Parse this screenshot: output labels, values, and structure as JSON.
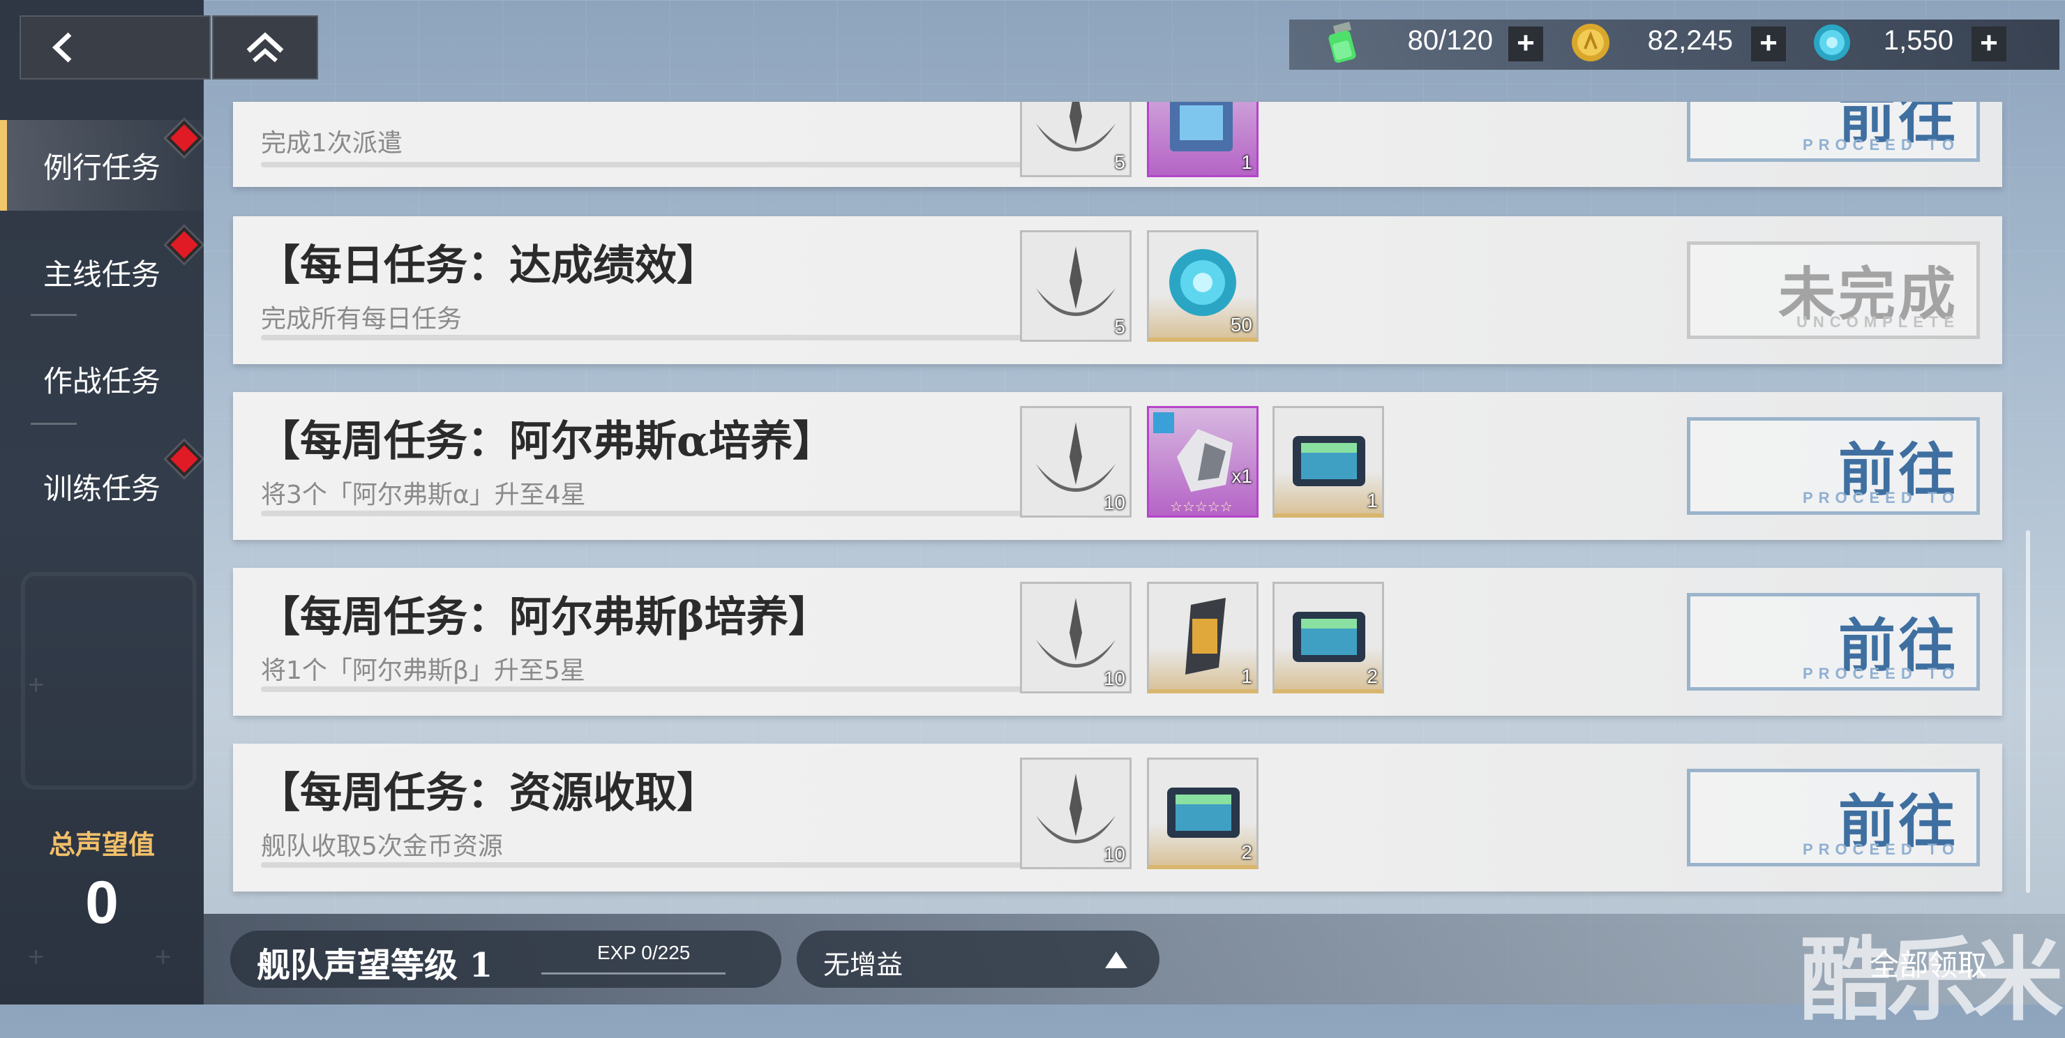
{
  "header": {
    "resources": [
      {
        "icon": "stamina-vial-icon",
        "value": "80/120"
      },
      {
        "icon": "gold-coin-icon",
        "value": "82,245"
      },
      {
        "icon": "crystal-orb-icon",
        "value": "1,550"
      }
    ],
    "plus_label": "+"
  },
  "sidebar": {
    "items": [
      {
        "label": "例行任务",
        "active": true,
        "has_alert": true
      },
      {
        "label": "主线任务",
        "active": false,
        "has_alert": true
      },
      {
        "label": "作战任务",
        "active": false,
        "has_alert": false
      },
      {
        "label": "训练任务",
        "active": false,
        "has_alert": true
      }
    ],
    "reputation_label": "总声望值",
    "reputation_value": "0"
  },
  "tasks": [
    {
      "title": "",
      "description": "完成1次派遣",
      "progress": "0/1",
      "rewards": [
        {
          "icon": "reputation-emblem-icon",
          "count": "5"
        },
        {
          "icon": "blueprint-card-icon",
          "count": "1"
        }
      ],
      "action": {
        "label": "前往",
        "sub": "PROCEED TO"
      }
    },
    {
      "title": "【每日任务：达成绩效】",
      "description": "完成所有每日任务",
      "progress": "0/4",
      "rewards": [
        {
          "icon": "reputation-emblem-icon",
          "count": "5"
        },
        {
          "icon": "crystal-orb-icon",
          "count": "50"
        }
      ],
      "action": {
        "label": "未完成",
        "sub": "UNCOMPLETE"
      }
    },
    {
      "title": "【每周任务：阿尔弗斯α培养】",
      "description": "将3个「阿尔弗斯α」升至4星",
      "progress": "0/3",
      "rewards": [
        {
          "icon": "reputation-emblem-icon",
          "count": "10"
        },
        {
          "icon": "mech-unit-card-icon",
          "count": "x1"
        },
        {
          "icon": "data-chip-icon",
          "count": "1"
        }
      ],
      "action": {
        "label": "前往",
        "sub": "PROCEED TO"
      }
    },
    {
      "title": "【每周任务：阿尔弗斯β培养】",
      "description": "将1个「阿尔弗斯β」升至5星",
      "progress": "0/1",
      "rewards": [
        {
          "icon": "reputation-emblem-icon",
          "count": "10"
        },
        {
          "icon": "parts-kit-icon",
          "count": "1"
        },
        {
          "icon": "data-chip-icon",
          "count": "2"
        }
      ],
      "action": {
        "label": "前往",
        "sub": "PROCEED TO"
      }
    },
    {
      "title": "【每周任务：资源收取】",
      "description": "舰队收取5次金币资源",
      "progress": "0/5",
      "rewards": [
        {
          "icon": "reputation-emblem-icon",
          "count": "10"
        },
        {
          "icon": "data-chip-icon",
          "count": "2"
        }
      ],
      "action": {
        "label": "前往",
        "sub": "PROCEED TO"
      }
    }
  ],
  "footer": {
    "level_label": "舰队声望等级 1",
    "exp_label": "EXP  0/225",
    "buff_label": "无增益",
    "claim_all_label": "全部领取",
    "watermark": "酷乐米"
  },
  "colors": {
    "accent_gold": "#f2c76a",
    "alert_red": "#e11b25",
    "action_blue": "#3f6fa0"
  }
}
